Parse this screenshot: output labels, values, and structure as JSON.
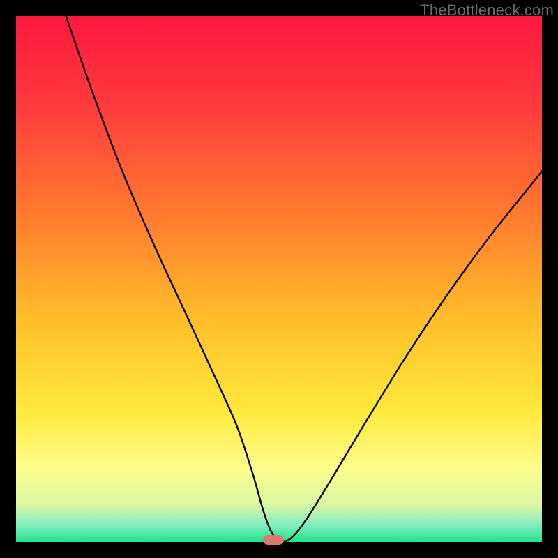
{
  "watermark": "TheBottleneck.com",
  "colors": {
    "frame": "#000000",
    "gradient_stops": [
      {
        "offset": 0.0,
        "color": "#ff173f"
      },
      {
        "offset": 0.18,
        "color": "#ff3d3d"
      },
      {
        "offset": 0.38,
        "color": "#ff7b2e"
      },
      {
        "offset": 0.58,
        "color": "#ffbf2a"
      },
      {
        "offset": 0.75,
        "color": "#ffe93a"
      },
      {
        "offset": 0.86,
        "color": "#fdfc8c"
      },
      {
        "offset": 0.93,
        "color": "#d9f7a2"
      },
      {
        "offset": 0.965,
        "color": "#88eec0"
      },
      {
        "offset": 1.0,
        "color": "#22e28a"
      }
    ],
    "curve": "#000000",
    "marker": "#d77a72"
  },
  "chart_data": {
    "type": "line",
    "title": "",
    "xlabel": "",
    "ylabel": "",
    "xlim": [
      0,
      100
    ],
    "ylim": [
      0,
      100
    ],
    "grid": false,
    "legend": false,
    "marker": {
      "x": 49,
      "y": 0
    },
    "series": [
      {
        "name": "curve",
        "x": [
          9.5,
          14,
          20,
          26,
          32,
          38,
          42,
          45,
          47,
          48.5,
          50,
          52,
          55,
          60,
          66,
          74,
          82,
          90,
          98,
          100
        ],
        "values": [
          100,
          87,
          71,
          57,
          44,
          31,
          22,
          13,
          6,
          2,
          0.5,
          0.5,
          4,
          12,
          22,
          35,
          47,
          58,
          68,
          70.5
        ]
      }
    ]
  }
}
